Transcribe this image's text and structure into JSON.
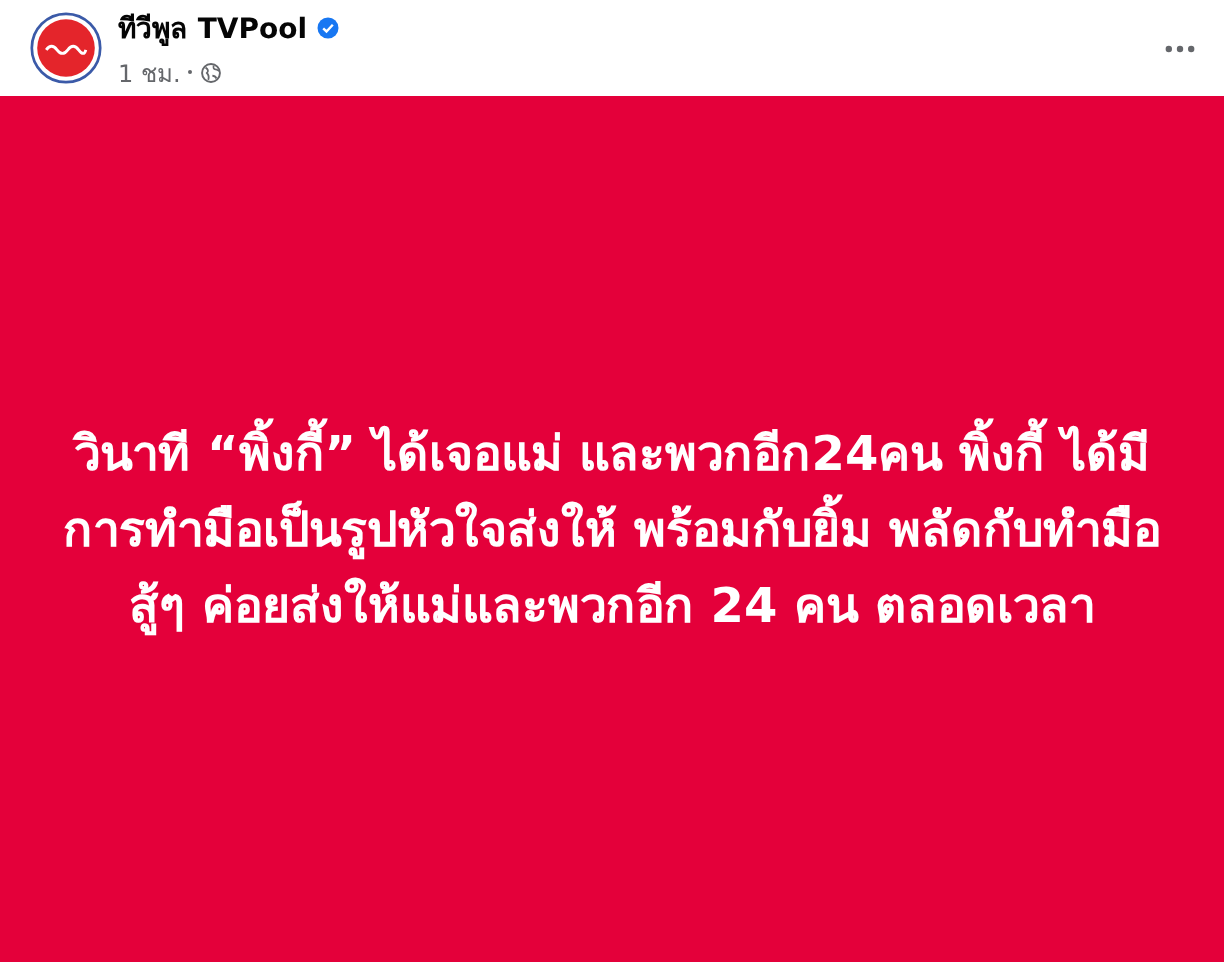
{
  "post": {
    "author": "ทีวีพูล TVPool",
    "verified": true,
    "time": "1 ชม.",
    "public": true,
    "text": "วินาที “พิ้งกี้” ได้เจอแม่ และพวกอีก24คน พิ้งกี้ ได้มีการทำมือเป็นรูปหัวใจส่งให้ พร้อมกับยิ้ม พลัดกับทำมือสู้ๆ ค่อยส่งให้แม่และพวกอีก 24 คน ตลอดเวลา"
  }
}
